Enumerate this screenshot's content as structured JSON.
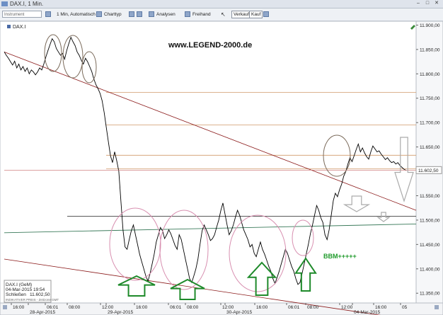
{
  "window": {
    "title": "DAX.I, 1 Min."
  },
  "toolbar": {
    "instrument_placeholder": "Instrument",
    "interval": "1 Min, Automatisch",
    "chart_type": "Charttyp",
    "analyses": "Analysen",
    "freehand": "Freihand",
    "sell": "Verkauf",
    "buy": "Kauf"
  },
  "chart": {
    "symbol": "DAX.I",
    "watermark": "www.LEGEND-2000.de",
    "annotation": "BBM+++++",
    "last_price_label": "11.602,50",
    "info_box": {
      "name": "DAX.I (GeM)",
      "date": "04-Mar-2015 19:54",
      "close_label": "Schließen",
      "close_value": "11.602,50",
      "indicator": "INDIKATIVER PREIS - Zeitzone GMT"
    },
    "colors": {
      "price": "#000000",
      "trend": "#8b1a1a",
      "level": "#d19a6a",
      "ma": "#3a7a5a",
      "arrow": "#1e8a2a",
      "ellipse": "#d88fb0"
    }
  },
  "chart_data": {
    "type": "line",
    "y_tick_labels": [
      "11.900,00",
      "11.850,00",
      "11.800,00",
      "11.750,00",
      "11.700,00",
      "11.650,00",
      "11.600,00",
      "11.550,00",
      "11.500,00",
      "11.450,00",
      "11.400,00",
      "11.350,00"
    ],
    "x_tick_labels": [
      "16:00",
      "28-Apr-2015",
      "06:01",
      "08:00",
      "12:00",
      "29-Apr-2015",
      "16:00",
      "06:01",
      "08:00",
      "12:00",
      "30-Apr-2015",
      "16:00",
      "06:01",
      "08:00",
      "12:00",
      "04-Mar-2015",
      "16:00",
      "05"
    ],
    "ylim": [
      11330,
      11905
    ],
    "series": [
      {
        "values": [
          11845,
          11838,
          11832,
          11825,
          11818,
          11826,
          11812,
          11820,
          11808,
          11815,
          11805,
          11812,
          11800,
          11808,
          11804,
          11798,
          11804,
          11812,
          11808,
          11820,
          11835,
          11848,
          11860,
          11872,
          11866,
          11852,
          11845,
          11838,
          11842,
          11830,
          11848,
          11862,
          11875,
          11866,
          11858,
          11845,
          11838,
          11828,
          11820,
          11832,
          11825,
          11815,
          11805,
          11790,
          11778,
          11770,
          11760,
          11745,
          11720,
          11690,
          11660,
          11632,
          11618,
          11640,
          11622,
          11600,
          11540,
          11480,
          11445,
          11440,
          11460,
          11478,
          11490,
          11470,
          11450,
          11430,
          11415,
          11400,
          11385,
          11375,
          11390,
          11410,
          11430,
          11455,
          11470,
          11485,
          11478,
          11462,
          11470,
          11480,
          11472,
          11460,
          11448,
          11440,
          11470,
          11460,
          11440,
          11420,
          11400,
          11380,
          11372,
          11385,
          11400,
          11420,
          11450,
          11478,
          11490,
          11480,
          11470,
          11458,
          11462,
          11470,
          11486,
          11500,
          11520,
          11535,
          11512,
          11490,
          11470,
          11478,
          11490,
          11506,
          11520,
          11510,
          11495,
          11480,
          11470,
          11460,
          11445,
          11450,
          11432,
          11425,
          11440,
          11455,
          11440,
          11430,
          11418,
          11405,
          11395,
          11380,
          11370,
          11382,
          11395,
          11410,
          11425,
          11440,
          11432,
          11418,
          11405,
          11395,
          11380,
          11368,
          11372,
          11390,
          11410,
          11430,
          11450,
          11472,
          11490,
          11510,
          11530,
          11520,
          11505,
          11495,
          11470,
          11460,
          11480,
          11510,
          11540,
          11555,
          11548,
          11562,
          11574,
          11590,
          11600,
          11615,
          11628,
          11620,
          11632,
          11645,
          11656,
          11640,
          11648,
          11638,
          11630,
          11625,
          11640,
          11652,
          11646,
          11640,
          11642,
          11635,
          11630,
          11624,
          11628,
          11622,
          11618,
          11620,
          11615,
          11618,
          11612,
          11608,
          11604,
          11602
        ]
      }
    ],
    "levels": [
      11762,
      11695,
      11633,
      11605,
      11508
    ],
    "trendlines": [
      {
        "from": [
          "x_start",
          11845
        ],
        "to": [
          "x_end",
          11520
        ]
      },
      {
        "from": [
          "x_start",
          11420
        ],
        "to": [
          "x_end",
          11300
        ]
      }
    ]
  }
}
